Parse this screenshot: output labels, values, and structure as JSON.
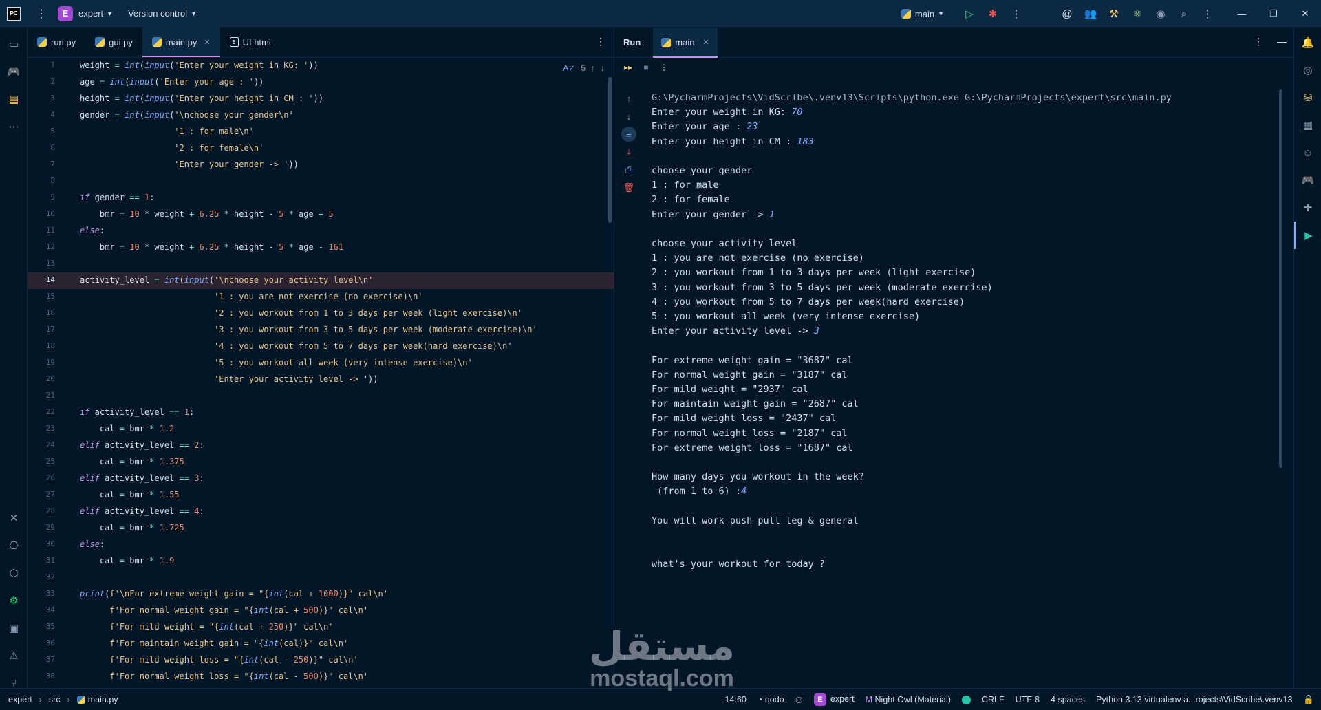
{
  "titlebar": {
    "app_logo_text": "PC",
    "menu_icon": "hamburger-menu-icon",
    "project_badge": "E",
    "project_name": "expert",
    "vcs_label": "Version control",
    "run_config": "main"
  },
  "editor": {
    "tabs": [
      {
        "label": "run.py",
        "icon": "python-file-icon"
      },
      {
        "label": "gui.py",
        "icon": "python-file-icon"
      },
      {
        "label": "main.py",
        "icon": "python-file-icon",
        "active": true
      },
      {
        "label": "UI.html",
        "icon": "html-file-icon"
      }
    ],
    "inspection_count": "5",
    "current_line": 14,
    "lines": [
      "weight = int(input('Enter your weight in KG: '))",
      "age = int(input('Enter your age : '))",
      "height = int(input('Enter your height in CM : '))",
      "gender = int(input('\\nchoose your gender\\n'",
      "                   '1 : for male\\n'",
      "                   '2 : for female\\n'",
      "                   'Enter your gender -> '))",
      "",
      "if gender == 1:",
      "    bmr = 10 * weight + 6.25 * height - 5 * age + 5",
      "else:",
      "    bmr = 10 * weight + 6.25 * height - 5 * age - 161",
      "",
      "activity_level = int(input('\\nchoose your activity level\\n'",
      "                           '1 : you are not exercise (no exercise)\\n'",
      "                           '2 : you workout from 1 to 3 days per week (light exercise)\\n'",
      "                           '3 : you workout from 3 to 5 days per week (moderate exercise)\\n'",
      "                           '4 : you workout from 5 to 7 days per week(hard exercise)\\n'",
      "                           '5 : you workout all week (very intense exercise)\\n'",
      "                           'Enter your activity level -> '))",
      "",
      "if activity_level == 1:",
      "    cal = bmr * 1.2",
      "elif activity_level == 2:",
      "    cal = bmr * 1.375",
      "elif activity_level == 3:",
      "    cal = bmr * 1.55",
      "elif activity_level == 4:",
      "    cal = bmr * 1.725",
      "else:",
      "    cal = bmr * 1.9",
      "",
      "print(f'\\nFor extreme weight gain = \"{int(cal + 1000)}\" cal\\n'",
      "      f'For normal weight gain = \"{int(cal + 500)}\" cal\\n'",
      "      f'For mild weight = \"{int(cal + 250)}\" cal\\n'",
      "      f'For maintain weight gain = \"{int(cal)}\" cal\\n'",
      "      f'For mild weight loss = \"{int(cal - 250)}\" cal\\n'",
      "      f'For normal weight loss = \"{int(cal - 500)}\" cal\\n'"
    ]
  },
  "run": {
    "title": "Run",
    "tab_label": "main",
    "output": [
      {
        "text": "G:\\PycharmProjects\\VidScribe\\.venv13\\Scripts\\python.exe G:\\PycharmProjects\\expert\\src\\main.py",
        "kind": "cmd"
      },
      {
        "text": "Enter your weight in KG: ",
        "input": "70"
      },
      {
        "text": "Enter your age : ",
        "input": "23"
      },
      {
        "text": "Enter your height in CM : ",
        "input": "183"
      },
      {
        "text": ""
      },
      {
        "text": "choose your gender"
      },
      {
        "text": "1 : for male"
      },
      {
        "text": "2 : for female"
      },
      {
        "text": "Enter your gender -> ",
        "input": "1"
      },
      {
        "text": ""
      },
      {
        "text": "choose your activity level"
      },
      {
        "text": "1 : you are not exercise (no exercise)"
      },
      {
        "text": "2 : you workout from 1 to 3 days per week (light exercise)"
      },
      {
        "text": "3 : you workout from 3 to 5 days per week (moderate exercise)"
      },
      {
        "text": "4 : you workout from 5 to 7 days per week(hard exercise)"
      },
      {
        "text": "5 : you workout all week (very intense exercise)"
      },
      {
        "text": "Enter your activity level -> ",
        "input": "3"
      },
      {
        "text": ""
      },
      {
        "text": "For extreme weight gain = \"3687\" cal"
      },
      {
        "text": "For normal weight gain = \"3187\" cal"
      },
      {
        "text": "For mild weight = \"2937\" cal"
      },
      {
        "text": "For maintain weight gain = \"2687\" cal"
      },
      {
        "text": "For mild weight loss = \"2437\" cal"
      },
      {
        "text": "For normal weight loss = \"2187\" cal"
      },
      {
        "text": "For extreme weight loss = \"1687\" cal"
      },
      {
        "text": ""
      },
      {
        "text": "How many days you workout in the week?"
      },
      {
        "text": " (from 1 to 6) :",
        "input": "4"
      },
      {
        "text": ""
      },
      {
        "text": "You will work push pull leg & general"
      },
      {
        "text": ""
      },
      {
        "text": ""
      },
      {
        "text": "what's your workout for today ?"
      }
    ]
  },
  "statusbar": {
    "breadcrumb": [
      "expert",
      "src",
      "main.py"
    ],
    "position": "14:60",
    "qodo": "qodo",
    "project_badge": "E",
    "project": "expert",
    "theme": "Night Owl (Material)",
    "line_sep": "CRLF",
    "encoding": "UTF-8",
    "indent": "4 spaces",
    "interpreter": "Python 3.13 virtualenv a...rojects\\VidScribe\\.venv13"
  },
  "watermark": {
    "arabic": "مستقل",
    "latin": "mostaql.com"
  },
  "colors": {
    "background": "#011627",
    "keyword": "#c792ea",
    "function": "#82aaff",
    "string": "#ecc48d",
    "number": "#f78c6c",
    "operator": "#7fdbca",
    "accent": "#c792ea"
  }
}
